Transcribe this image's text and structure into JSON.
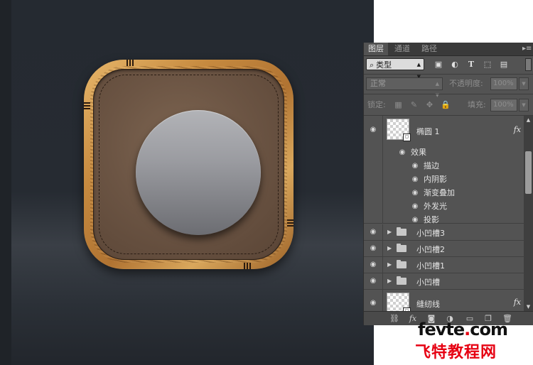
{
  "layers_panel": {
    "tabs": [
      {
        "label": "图层",
        "active": true
      },
      {
        "label": "通道",
        "active": false
      },
      {
        "label": "路径",
        "active": false
      }
    ],
    "filter": {
      "kind": "类型",
      "icons": [
        "image-filter-icon",
        "adjustment-filter-icon",
        "type-filter-icon",
        "shape-filter-icon",
        "smart-object-filter-icon"
      ]
    },
    "blend_mode": "正常",
    "opacity_label": "不透明度:",
    "opacity_value": "100%",
    "lock_label": "锁定:",
    "fill_label": "填充:",
    "fill_value": "100%",
    "layers": [
      {
        "name": "椭圆 1",
        "type": "shape",
        "fx": "fx",
        "effects_label": "效果",
        "effects": [
          "描边",
          "内阴影",
          "渐变叠加",
          "外发光",
          "投影"
        ]
      },
      {
        "name": "小凹槽3",
        "type": "group"
      },
      {
        "name": "小凹槽2",
        "type": "group"
      },
      {
        "name": "小凹槽1",
        "type": "group"
      },
      {
        "name": "小凹槽",
        "type": "group"
      },
      {
        "name": "缝纫线",
        "type": "shape",
        "fx": "fx"
      }
    ],
    "bottom_icons": [
      "link-layers-icon",
      "fx-icon",
      "mask-icon",
      "adjustment-layer-icon",
      "new-group-icon",
      "new-layer-icon",
      "trash-icon"
    ]
  },
  "watermark": {
    "domain": "fevte",
    "dot": ".",
    "tld": "com",
    "cn": "飞特教程网"
  },
  "colors": {
    "canvas_bg": "#262b32",
    "panel_bg": "#535353",
    "wood": "#c68a3f",
    "leather": "#6c5544",
    "watermark_red": "#e60012"
  }
}
